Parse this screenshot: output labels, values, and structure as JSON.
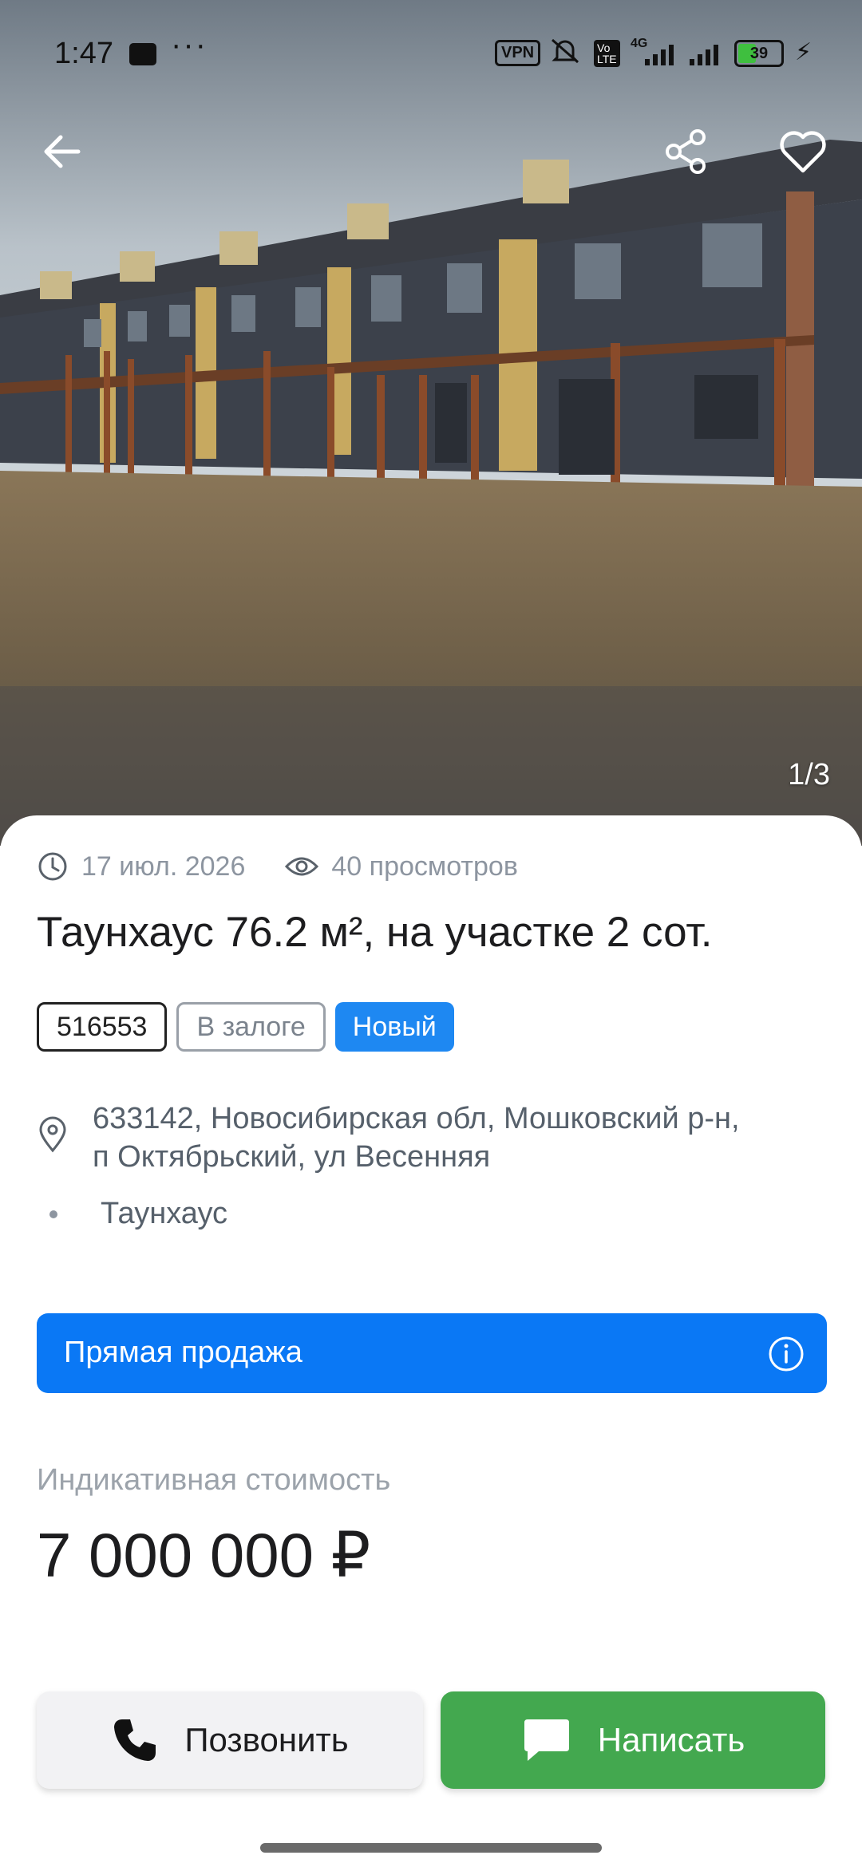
{
  "status_bar": {
    "time": "1:47",
    "dots": "···",
    "vpn": "VPN",
    "volte": "Vo\nLTE",
    "network": "4G",
    "battery": "39",
    "battery_level": 0.39
  },
  "gallery": {
    "counter": "1/3",
    "icons": [
      "back-arrow-icon",
      "share-icon",
      "heart-icon"
    ]
  },
  "listing": {
    "date": "17 июл. 2026",
    "views": "40 просмотров",
    "title": "Таунхаус 76.2 м², на участке 2 сот.",
    "tags": {
      "id": "516553",
      "pledge": "В залоге",
      "new": "Новый"
    },
    "address_line1": "633142, Новосибирская обл, Мошковский р-н,",
    "address_line2": "п Октябрьский, ул Весенняя",
    "type": "Таунхаус"
  },
  "direct_sale": {
    "label": "Прямая продажа"
  },
  "price": {
    "label": "Индикативная стоимость",
    "value": "7 000 000 ₽"
  },
  "actions": {
    "call": "Позвонить",
    "write": "Написать"
  },
  "colors": {
    "accent_blue": "#0a78f5",
    "tag_blue": "#1e88f2",
    "green": "#43a84f"
  }
}
